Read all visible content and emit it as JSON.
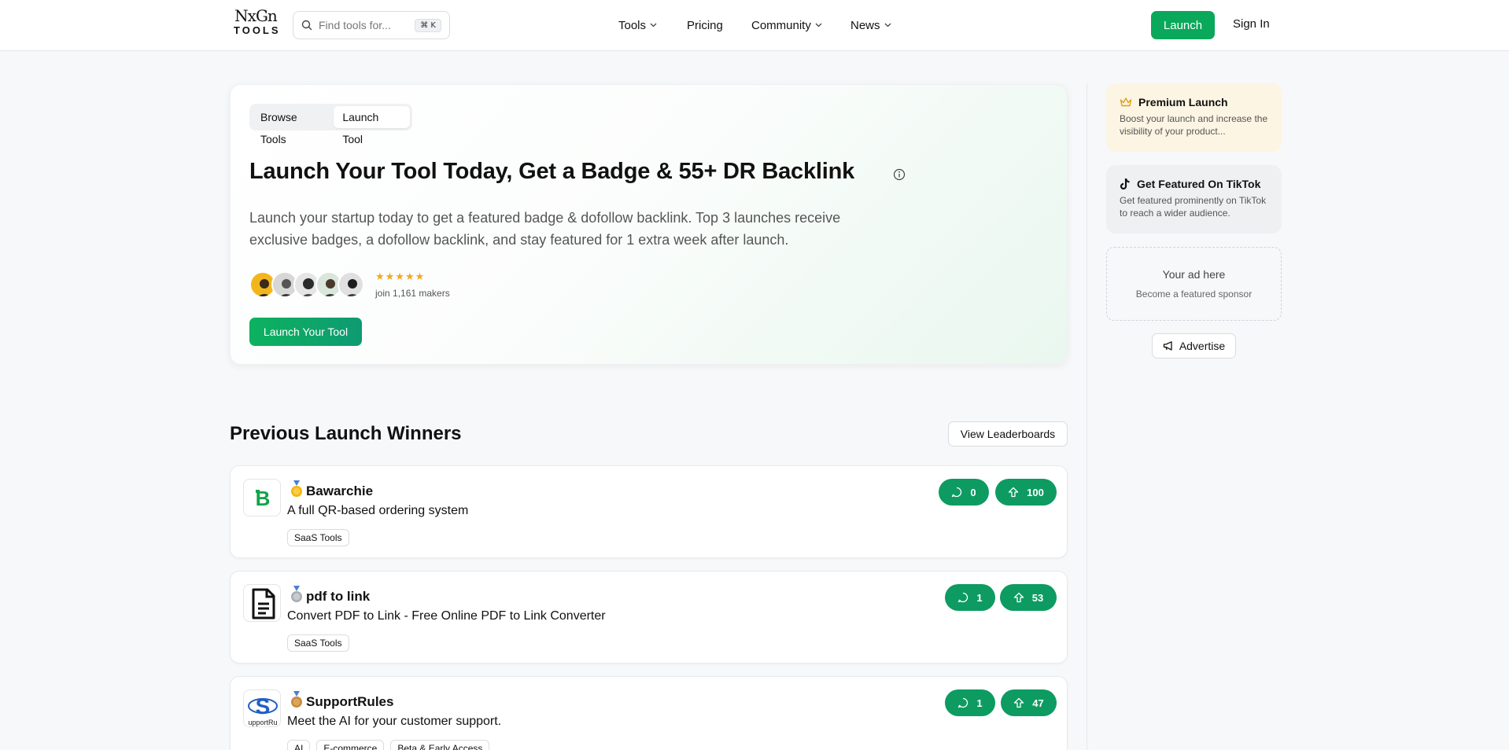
{
  "header": {
    "logo_top": "NxGn",
    "logo_bottom": "TOOLS",
    "search_placeholder": "Find tools for...",
    "search_shortcut": "⌘ K",
    "nav": [
      "Tools",
      "Pricing",
      "Community",
      "News"
    ],
    "launch_label": "Launch",
    "signin_label": "Sign In"
  },
  "hero": {
    "toggle": [
      "Browse Tools",
      "Launch Tool"
    ],
    "title": "Launch Your Tool Today, Get a Badge & 55+ DR Backlink",
    "description": "Launch your startup today to get a featured badge & dofollow backlink. Top 3 launches receive exclusive badges, a dofollow backlink, and stay featured for 1 extra week after launch.",
    "stars": "★★★★★",
    "makers": "join 1,161 makers",
    "cta": "Launch Your Tool"
  },
  "winners": {
    "title": "Previous Launch Winners",
    "leaderboards_label": "View Leaderboards",
    "items": [
      {
        "name": "Bawarchie",
        "tagline": "A full QR-based ordering system",
        "tags": [
          "SaaS Tools"
        ],
        "comments": "0",
        "upvotes": "100",
        "medal": "gold"
      },
      {
        "name": "pdf to link",
        "tagline": "Convert PDF to Link - Free Online PDF to Link Converter",
        "tags": [
          "SaaS Tools"
        ],
        "comments": "1",
        "upvotes": "53",
        "medal": "silver"
      },
      {
        "name": "SupportRules",
        "tagline": "Meet the AI for your customer support.",
        "tags": [
          "AI",
          "E-commerce",
          "Beta & Early Access"
        ],
        "comments": "1",
        "upvotes": "47",
        "medal": "bronze"
      }
    ]
  },
  "sidebar": {
    "premium_title": "Premium Launch",
    "premium_desc": "Boost your launch and increase the visibility of your product...",
    "tiktok_title": "Get Featured On TikTok",
    "tiktok_desc": "Get featured prominently on TikTok to reach a wider audience.",
    "ad_title": "Your ad here",
    "ad_sub": "Become a featured sponsor",
    "advertise_label": "Advertise"
  },
  "colors": {
    "accent": "#0aa85b",
    "pill": "#0d9b62",
    "star": "#f5a623"
  }
}
